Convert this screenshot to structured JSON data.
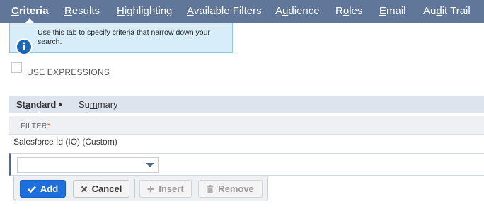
{
  "topnav": {
    "tabs": [
      {
        "pre": "",
        "acc": "C",
        "post": "riteria",
        "active": true
      },
      {
        "pre": "",
        "acc": "R",
        "post": "esults",
        "active": false
      },
      {
        "pre": "",
        "acc": "H",
        "post": "ighlighting",
        "active": false
      },
      {
        "pre": "",
        "acc": "A",
        "post": "vailable Filters",
        "active": false
      },
      {
        "pre": "A",
        "acc": "u",
        "post": "dience",
        "active": false
      },
      {
        "pre": "R",
        "acc": "o",
        "post": "les",
        "active": false
      },
      {
        "pre": "",
        "acc": "E",
        "post": "mail",
        "active": false
      },
      {
        "pre": "Au",
        "acc": "d",
        "post": "it Trail",
        "active": false
      }
    ]
  },
  "info": {
    "text": "Use this tab to specify criteria that narrow down your search.",
    "icon": "info-icon"
  },
  "use_expressions": {
    "label": "USE EXPRESSIONS",
    "checked": false
  },
  "subtabs": [
    {
      "pre": "St",
      "acc": "a",
      "post": "ndard •",
      "active": true
    },
    {
      "pre": "Su",
      "acc": "m",
      "post": "mary",
      "active": false
    }
  ],
  "filter": {
    "header": "FILTER",
    "required_mark": "*",
    "row_value": "Salesforce Id (IO) (Custom)",
    "select_value": ""
  },
  "buttons": {
    "add": "Add",
    "cancel": "Cancel",
    "insert": "Insert",
    "remove": "Remove"
  },
  "colors": {
    "nav_bg": "#607799",
    "accent": "#1e6fdc",
    "info_bg": "#d7eefa"
  }
}
